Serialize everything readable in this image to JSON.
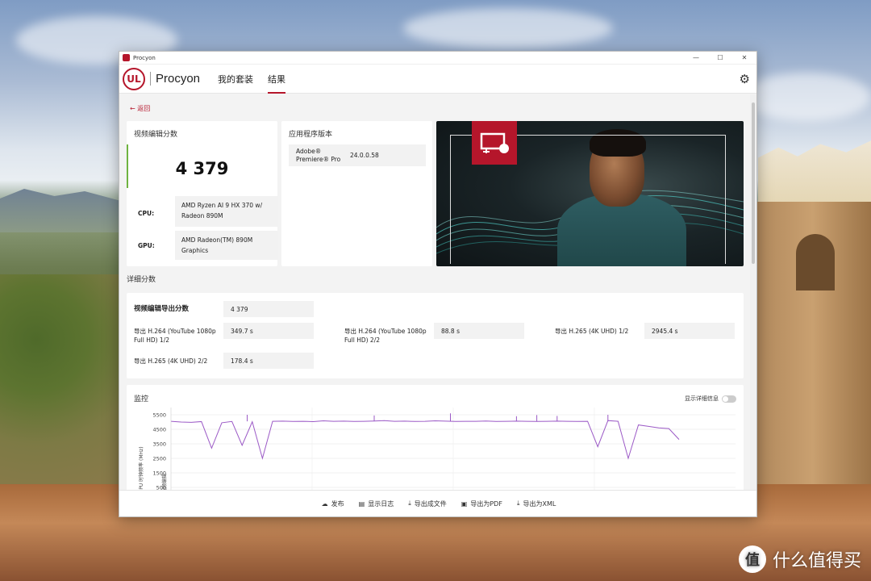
{
  "window": {
    "title": "Procyon",
    "controls": [
      "—",
      "☐",
      "✕"
    ]
  },
  "header": {
    "logo_text": "UL",
    "brand": "Procyon",
    "tabs": [
      {
        "label": "我的套装",
        "active": false
      },
      {
        "label": "结果",
        "active": true
      }
    ],
    "settings_icon": "gear-icon"
  },
  "back": {
    "label": "返回"
  },
  "score_card": {
    "title": "视频编辑分数",
    "score": "4 379",
    "cpu_label": "CPU:",
    "cpu_value": "AMD Ryzen AI 9 HX 370 w/ Radeon 890M",
    "gpu_label": "GPU:",
    "gpu_value": "AMD Radeon(TM) 890M Graphics"
  },
  "version_card": {
    "title": "应用程序版本",
    "app_name": "Adobe® Premiere® Pro",
    "app_version": "24.0.0.58"
  },
  "details": {
    "section_title": "详细分数",
    "total_label": "视频编辑导出分数",
    "total_value": "4 379",
    "items": [
      {
        "label": "导出 H.264 (YouTube 1080p Full HD) 1/2",
        "value": "349.7 s"
      },
      {
        "label": "导出 H.264 (YouTube 1080p Full HD) 2/2",
        "value": "88.8 s"
      },
      {
        "label": "导出 H.265 (4K UHD) 1/2",
        "value": "2945.4 s"
      },
      {
        "label": "导出 H.265 (4K UHD) 2/2",
        "value": "178.4 s"
      }
    ]
  },
  "monitor": {
    "title": "监控",
    "toggle_label": "显示详细信息",
    "toggle_on": false
  },
  "chart_data": {
    "type": "line",
    "ylabel": "CPU 时钟频率 (MHz)",
    "xlabel": "",
    "secondary_label": "视频编辑",
    "y_ticks": [
      5500,
      4500,
      3500,
      2500,
      1500,
      500
    ],
    "ylim": [
      0,
      6000
    ],
    "color": "#9b59c6",
    "baseline": 5050,
    "x": [
      0,
      2,
      4,
      6,
      8,
      10,
      12,
      14,
      16,
      18,
      20,
      22,
      24,
      26,
      28,
      30,
      32,
      34,
      36,
      38,
      40,
      42,
      44,
      46,
      48,
      50,
      52,
      54,
      56,
      58,
      60,
      62,
      64,
      66,
      68,
      70,
      72,
      74,
      76,
      78,
      80,
      82,
      84,
      86,
      88,
      90,
      92,
      94,
      96,
      98,
      100
    ],
    "values": [
      5050,
      5000,
      4980,
      5030,
      3200,
      4950,
      5040,
      3400,
      5020,
      2500,
      5050,
      5060,
      5040,
      5050,
      5030,
      5080,
      5050,
      5060,
      5040,
      5050,
      5070,
      5100,
      5050,
      5060,
      5040,
      5050,
      5080,
      5060,
      5040,
      5050,
      5050,
      5070,
      5040,
      5050,
      5060,
      5050,
      5040,
      5050,
      5060,
      5050,
      5040,
      5050,
      3300,
      5100,
      5050,
      2500,
      4800,
      4700,
      4600,
      4550,
      3800
    ],
    "spikes_x": [
      15,
      40,
      55,
      68,
      72,
      76,
      86
    ],
    "spikes_y": [
      5500,
      5450,
      5600,
      5400,
      5480,
      5420,
      5500
    ]
  },
  "footer": {
    "buttons": [
      {
        "label": "发布",
        "icon": "cloud-upload-icon"
      },
      {
        "label": "显示日志",
        "icon": "document-icon"
      },
      {
        "label": "导出成文件",
        "icon": "download-icon"
      },
      {
        "label": "导出为PDF",
        "icon": "pdf-icon"
      },
      {
        "label": "导出为XML",
        "icon": "download-icon"
      }
    ]
  },
  "watermark": {
    "text": "什么值得买",
    "mark": "值"
  },
  "colors": {
    "accent": "#b5162b",
    "score_accent": "#6fb33f",
    "chart_line": "#9b59c6"
  }
}
